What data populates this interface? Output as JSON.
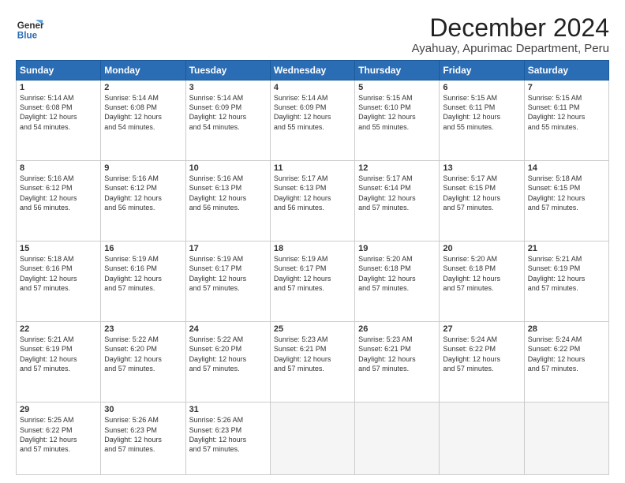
{
  "header": {
    "logo_line1": "General",
    "logo_line2": "Blue",
    "main_title": "December 2024",
    "subtitle": "Ayahuay, Apurimac Department, Peru"
  },
  "days_of_week": [
    "Sunday",
    "Monday",
    "Tuesday",
    "Wednesday",
    "Thursday",
    "Friday",
    "Saturday"
  ],
  "weeks": [
    [
      {
        "day": 1,
        "info": "Sunrise: 5:14 AM\nSunset: 6:08 PM\nDaylight: 12 hours\nand 54 minutes."
      },
      {
        "day": 2,
        "info": "Sunrise: 5:14 AM\nSunset: 6:08 PM\nDaylight: 12 hours\nand 54 minutes."
      },
      {
        "day": 3,
        "info": "Sunrise: 5:14 AM\nSunset: 6:09 PM\nDaylight: 12 hours\nand 54 minutes."
      },
      {
        "day": 4,
        "info": "Sunrise: 5:14 AM\nSunset: 6:09 PM\nDaylight: 12 hours\nand 55 minutes."
      },
      {
        "day": 5,
        "info": "Sunrise: 5:15 AM\nSunset: 6:10 PM\nDaylight: 12 hours\nand 55 minutes."
      },
      {
        "day": 6,
        "info": "Sunrise: 5:15 AM\nSunset: 6:11 PM\nDaylight: 12 hours\nand 55 minutes."
      },
      {
        "day": 7,
        "info": "Sunrise: 5:15 AM\nSunset: 6:11 PM\nDaylight: 12 hours\nand 55 minutes."
      }
    ],
    [
      {
        "day": 8,
        "info": "Sunrise: 5:16 AM\nSunset: 6:12 PM\nDaylight: 12 hours\nand 56 minutes."
      },
      {
        "day": 9,
        "info": "Sunrise: 5:16 AM\nSunset: 6:12 PM\nDaylight: 12 hours\nand 56 minutes."
      },
      {
        "day": 10,
        "info": "Sunrise: 5:16 AM\nSunset: 6:13 PM\nDaylight: 12 hours\nand 56 minutes."
      },
      {
        "day": 11,
        "info": "Sunrise: 5:17 AM\nSunset: 6:13 PM\nDaylight: 12 hours\nand 56 minutes."
      },
      {
        "day": 12,
        "info": "Sunrise: 5:17 AM\nSunset: 6:14 PM\nDaylight: 12 hours\nand 57 minutes."
      },
      {
        "day": 13,
        "info": "Sunrise: 5:17 AM\nSunset: 6:15 PM\nDaylight: 12 hours\nand 57 minutes."
      },
      {
        "day": 14,
        "info": "Sunrise: 5:18 AM\nSunset: 6:15 PM\nDaylight: 12 hours\nand 57 minutes."
      }
    ],
    [
      {
        "day": 15,
        "info": "Sunrise: 5:18 AM\nSunset: 6:16 PM\nDaylight: 12 hours\nand 57 minutes."
      },
      {
        "day": 16,
        "info": "Sunrise: 5:19 AM\nSunset: 6:16 PM\nDaylight: 12 hours\nand 57 minutes."
      },
      {
        "day": 17,
        "info": "Sunrise: 5:19 AM\nSunset: 6:17 PM\nDaylight: 12 hours\nand 57 minutes."
      },
      {
        "day": 18,
        "info": "Sunrise: 5:19 AM\nSunset: 6:17 PM\nDaylight: 12 hours\nand 57 minutes."
      },
      {
        "day": 19,
        "info": "Sunrise: 5:20 AM\nSunset: 6:18 PM\nDaylight: 12 hours\nand 57 minutes."
      },
      {
        "day": 20,
        "info": "Sunrise: 5:20 AM\nSunset: 6:18 PM\nDaylight: 12 hours\nand 57 minutes."
      },
      {
        "day": 21,
        "info": "Sunrise: 5:21 AM\nSunset: 6:19 PM\nDaylight: 12 hours\nand 57 minutes."
      }
    ],
    [
      {
        "day": 22,
        "info": "Sunrise: 5:21 AM\nSunset: 6:19 PM\nDaylight: 12 hours\nand 57 minutes."
      },
      {
        "day": 23,
        "info": "Sunrise: 5:22 AM\nSunset: 6:20 PM\nDaylight: 12 hours\nand 57 minutes."
      },
      {
        "day": 24,
        "info": "Sunrise: 5:22 AM\nSunset: 6:20 PM\nDaylight: 12 hours\nand 57 minutes."
      },
      {
        "day": 25,
        "info": "Sunrise: 5:23 AM\nSunset: 6:21 PM\nDaylight: 12 hours\nand 57 minutes."
      },
      {
        "day": 26,
        "info": "Sunrise: 5:23 AM\nSunset: 6:21 PM\nDaylight: 12 hours\nand 57 minutes."
      },
      {
        "day": 27,
        "info": "Sunrise: 5:24 AM\nSunset: 6:22 PM\nDaylight: 12 hours\nand 57 minutes."
      },
      {
        "day": 28,
        "info": "Sunrise: 5:24 AM\nSunset: 6:22 PM\nDaylight: 12 hours\nand 57 minutes."
      }
    ],
    [
      {
        "day": 29,
        "info": "Sunrise: 5:25 AM\nSunset: 6:22 PM\nDaylight: 12 hours\nand 57 minutes."
      },
      {
        "day": 30,
        "info": "Sunrise: 5:26 AM\nSunset: 6:23 PM\nDaylight: 12 hours\nand 57 minutes."
      },
      {
        "day": 31,
        "info": "Sunrise: 5:26 AM\nSunset: 6:23 PM\nDaylight: 12 hours\nand 57 minutes."
      },
      null,
      null,
      null,
      null
    ]
  ]
}
